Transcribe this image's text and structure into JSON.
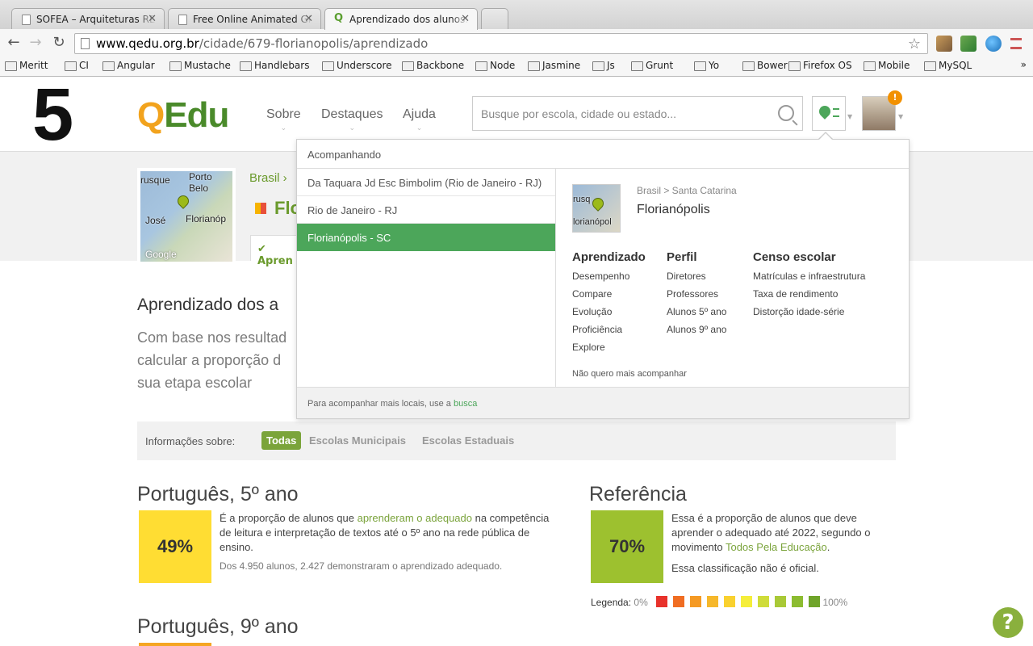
{
  "browser": {
    "tabs": [
      {
        "title": "SOFEA – Arquiteturas REST",
        "active": false
      },
      {
        "title": "Free Online Animated GIF M",
        "active": false
      },
      {
        "title": "Aprendizado dos alunos: F",
        "active": true
      }
    ],
    "url_host": "www.qedu.org.br",
    "url_path": "/cidade/679-florianopolis/aprendizado",
    "bookmarks": [
      "Meritt",
      "CI",
      "Angular",
      "Mustache",
      "Handlebars",
      "Underscore",
      "Backbone",
      "Node",
      "Jasmine",
      "Js",
      "Grunt",
      "Yo",
      "Bower",
      "Firefox OS",
      "Mobile",
      "MySQL"
    ],
    "bookmarks_more": "»"
  },
  "overlay": {
    "big_number": "5"
  },
  "header": {
    "logo_q": "Q",
    "logo_rest": "Edu",
    "nav": [
      "Sobre",
      "Destaques",
      "Ajuda"
    ],
    "nav_caret": "⌄",
    "search_placeholder": "Busque por escola, cidade ou estado...",
    "notification_badge": "!"
  },
  "city_header": {
    "map_labels": [
      "rusque",
      "Porto Belo",
      "José",
      "Florianóp",
      "Google"
    ],
    "breadcrumb": "Brasil ›",
    "name": "Flo",
    "active_tab": "✔ Apren"
  },
  "dropdown": {
    "heading": "Acompanhando",
    "items": [
      {
        "label": "Da Taquara Jd Esc Bimbolim (Rio de Janeiro - RJ)",
        "selected": false
      },
      {
        "label": "Rio de Janeiro - RJ",
        "selected": false
      },
      {
        "label": "Florianópolis - SC",
        "selected": true
      }
    ],
    "detail": {
      "map_labels": [
        "rusq",
        "lorianópol"
      ],
      "breadcrumb": "Brasil > Santa Catarina",
      "city": "Florianópolis",
      "columns": [
        {
          "heading": "Aprendizado",
          "links": [
            "Desempenho",
            "Compare",
            "Evolução",
            "Proficiência",
            "Explore"
          ]
        },
        {
          "heading": "Perfil",
          "links": [
            "Diretores",
            "Professores",
            "Alunos 5º ano",
            "Alunos 9º ano"
          ]
        },
        {
          "heading": "Censo escolar",
          "links": [
            "Matrículas e infraestrutura",
            "Taxa de rendimento",
            "Distorção idade-série"
          ]
        }
      ],
      "unfollow": "Não quero mais acompanhar"
    },
    "footer_text": "Para acompanhar mais locais, use a",
    "footer_link": "busca"
  },
  "main": {
    "title": "Aprendizado dos a",
    "intro_lines": [
      "Com base nos resultad",
      "calcular a proporção d",
      "sua etapa escolar"
    ],
    "filter": {
      "label": "Informações sobre:",
      "options": [
        {
          "label": "Todas",
          "active": true
        },
        {
          "label": "Escolas Municipais",
          "active": false
        },
        {
          "label": "Escolas Estaduais",
          "active": false
        }
      ]
    },
    "portugues5": {
      "title": "Português, 5º ano",
      "percent": "49%",
      "color": "#ffdd33",
      "text_before": "É a proporção de alunos que",
      "link": "aprenderam o adequado",
      "text_after": "na competência de leitura e interpretação de textos até o 5º ano na rede pública de ensino.",
      "detail": "Dos 4.950 alunos, 2.427 demonstraram o aprendizado adequado."
    },
    "referencia": {
      "title": "Referência",
      "percent": "70%",
      "color": "#9dc12f",
      "text_before": "Essa é a proporção de alunos que deve aprender o adequado até 2022, segundo o movimento",
      "link": "Todos Pela Educação",
      "text_after": ".",
      "note": "Essa classificação não é oficial."
    },
    "legend": {
      "label": "Legenda:",
      "min": "0%",
      "max": "100%",
      "colors": [
        "#e8322b",
        "#f06d22",
        "#f59a24",
        "#f6b82b",
        "#f9d12f",
        "#f5ee3a",
        "#cfdc3a",
        "#a9c937",
        "#8cbc30",
        "#6fa42a"
      ]
    },
    "portugues9": {
      "title": "Português, 9º ano",
      "color": "#f5a623"
    },
    "help": "?"
  }
}
